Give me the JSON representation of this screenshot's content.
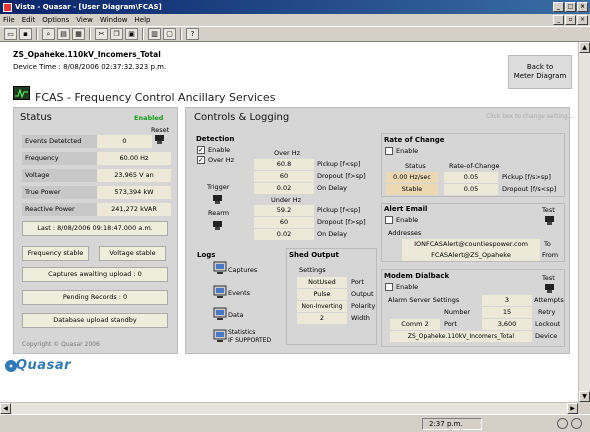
{
  "window": {
    "title": "Vista - Quasar - [User Diagram\\FCAS]"
  },
  "menu": [
    "File",
    "Edit",
    "Options",
    "View",
    "Window",
    "Help"
  ],
  "toolbar_icons": [
    "open-icon",
    "save-icon",
    "find-icon",
    "panel-icon",
    "table-icon",
    "cut-icon",
    "copy-icon",
    "paste-icon",
    "print-icon",
    "window-icon",
    "help-icon"
  ],
  "header": {
    "device_name": "ZS_Opaheke.110kV_Incomers_Total",
    "device_time": "Device Time : 8/08/2006 02:37:32.323 p.m.",
    "back_button": "Back to\nMeter Diagram"
  },
  "page_title": "FCAS - Frequency Control Ancillary Services",
  "status": {
    "title": "Status",
    "enabled": "Enabled",
    "reset": "Reset",
    "rows": [
      {
        "label": "Events Detetcted",
        "value": "0"
      },
      {
        "label": "Frequency",
        "value": "60.00 Hz"
      },
      {
        "label": "Voltage",
        "value": "23,965 V an"
      },
      {
        "label": "True Power",
        "value": "573,394 kW"
      },
      {
        "label": "Reactive Power",
        "value": "241,272 kVAR"
      }
    ],
    "last": "Last : 8/08/2006 09:18:47.000 a.m.",
    "freq_stable": "Frequency stable",
    "volt_stable": "Voltage stable",
    "captures": "Captures awaiting upload : 0",
    "pending": "Pending Records : 0",
    "db_standby": "Database upload standby",
    "copyright": "Copyright © Quasar 2006"
  },
  "controls": {
    "title": "Controls & Logging",
    "hint": "Click box to change setting...",
    "detection": {
      "title": "Detection",
      "enable": "Enable",
      "over_hz": "Over Hz",
      "trigger": "Trigger",
      "rearm": "Rearm",
      "overhz_title": "Over Hz",
      "underhz_title": "Under Hz",
      "over": [
        {
          "value": "60.8",
          "label": "Pickup [f<sp]"
        },
        {
          "value": "60",
          "label": "Dropout [f>sp]"
        },
        {
          "value": "0.02",
          "label": "On Delay"
        }
      ],
      "under": [
        {
          "value": "59.2",
          "label": "Pickup [f<sp]"
        },
        {
          "value": "60",
          "label": "Dropout [f>sp]"
        },
        {
          "value": "0.02",
          "label": "On Delay"
        }
      ]
    },
    "rate": {
      "title": "Rate of Change",
      "enable": "Enable",
      "status_hdr": "Status",
      "roc_hdr": "Rate-of-Change",
      "status_val": "0.00 Hz/sec",
      "status2": "Stable",
      "rows": [
        {
          "value": "0.05",
          "label": "Pickup [f/s>sp]"
        },
        {
          "value": "0.05",
          "label": "Dropout [f/s<sp]"
        }
      ]
    },
    "alert": {
      "title": "Alert Email",
      "enable": "Enable",
      "test": "Test",
      "addresses": "Addresses",
      "to_val": "IONFCASAlert@countiespower.com",
      "to_lbl": "To",
      "from_val": "FCASAlert@ZS_Opaheke",
      "from_lbl": "From"
    },
    "logs": {
      "title": "Logs",
      "items": [
        "Captures",
        "Events",
        "Data",
        "Statistics\nIF SUPPORTED"
      ]
    },
    "shed": {
      "title": "Shed Output",
      "settings": "Settings",
      "rows": [
        {
          "value": "NotUsed",
          "label": "Port"
        },
        {
          "value": "Pulse",
          "label": "Output"
        },
        {
          "value": "Non-Inverting",
          "label": "Polarity"
        },
        {
          "value": "2",
          "label": "Width"
        }
      ]
    },
    "modem": {
      "title": "Modem Dialback",
      "enable": "Enable",
      "test": "Test",
      "alarm": "Alarm Server Settings",
      "attempts_val": "3",
      "attempts_lbl": "Attempts",
      "number_lbl": "Number",
      "retry_val": "15",
      "retry_lbl": "Retry",
      "comm_val": "Comm 2",
      "port_lbl": "Port",
      "lockout_val": "3,600",
      "lockout_lbl": "Lockout",
      "device_val": "ZS_Opaheke.110kV_Incomers_Total",
      "device_lbl": "Device"
    }
  },
  "logo": "Quasar",
  "statusbar": {
    "time": "2:37 p.m."
  }
}
